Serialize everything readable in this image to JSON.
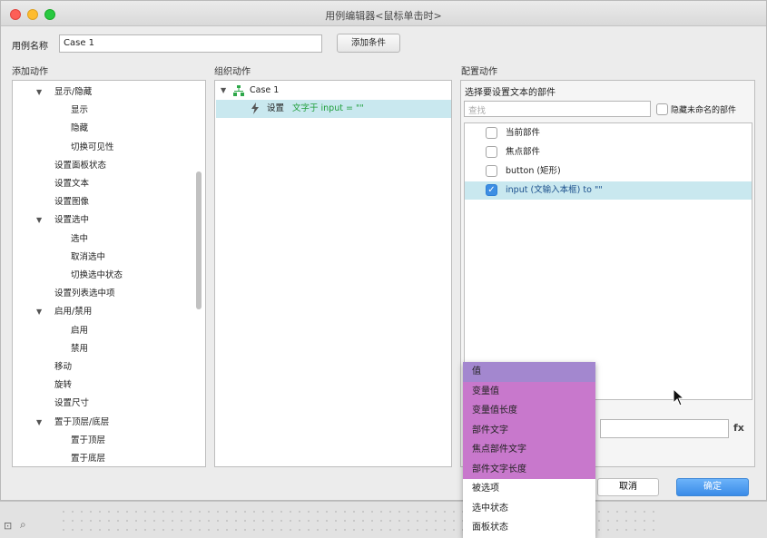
{
  "window": {
    "title": "用例编辑器<鼠标单击时>"
  },
  "case": {
    "label": "用例名称",
    "value": "Case 1",
    "add_condition": "添加条件"
  },
  "sections": {
    "add_action": "添加动作",
    "organize_action": "组织动作",
    "config_action": "配置动作"
  },
  "add_action_tree": [
    {
      "label": "显示/隐藏",
      "level": 1,
      "expanded": true
    },
    {
      "label": "显示",
      "level": 2
    },
    {
      "label": "隐藏",
      "level": 2
    },
    {
      "label": "切换可见性",
      "level": 2
    },
    {
      "label": "设置面板状态",
      "level": 1
    },
    {
      "label": "设置文本",
      "level": 1
    },
    {
      "label": "设置图像",
      "level": 1
    },
    {
      "label": "设置选中",
      "level": 1,
      "expanded": true
    },
    {
      "label": "选中",
      "level": 2
    },
    {
      "label": "取消选中",
      "level": 2
    },
    {
      "label": "切换选中状态",
      "level": 2
    },
    {
      "label": "设置列表选中项",
      "level": 1
    },
    {
      "label": "启用/禁用",
      "level": 1,
      "expanded": true
    },
    {
      "label": "启用",
      "level": 2
    },
    {
      "label": "禁用",
      "level": 2
    },
    {
      "label": "移动",
      "level": 1
    },
    {
      "label": "旋转",
      "level": 1
    },
    {
      "label": "设置尺寸",
      "level": 1
    },
    {
      "label": "置于顶层/底层",
      "level": 1,
      "expanded": true
    },
    {
      "label": "置于顶层",
      "level": 2
    },
    {
      "label": "置于底层",
      "level": 2
    }
  ],
  "organize_tree": {
    "case_name": "Case 1",
    "action_prefix": "设置",
    "action_detail": "文字于 input = \"\""
  },
  "config": {
    "choose_widget_label": "选择要设置文本的部件",
    "search_placeholder": "查找",
    "hide_unnamed_label": "隐藏未命名的部件",
    "widgets": [
      {
        "label": "当前部件",
        "checked": false
      },
      {
        "label": "焦点部件",
        "checked": false
      },
      {
        "label": "button (矩形)",
        "checked": false
      },
      {
        "label": "input (文输入本框) to \"\"",
        "checked": true
      }
    ],
    "fx_label": "fx"
  },
  "dropdown": {
    "items": [
      {
        "label": "值",
        "style": "highlight"
      },
      {
        "label": "变量值",
        "style": "purple"
      },
      {
        "label": "变量值长度",
        "style": "purple"
      },
      {
        "label": "部件文字",
        "style": "purple"
      },
      {
        "label": "焦点部件文字",
        "style": "purple"
      },
      {
        "label": "部件文字长度",
        "style": "purple"
      },
      {
        "label": "被选项",
        "style": "plain"
      },
      {
        "label": "选中状态",
        "style": "plain"
      },
      {
        "label": "面板状态",
        "style": "plain"
      }
    ]
  },
  "buttons": {
    "cancel": "取消",
    "ok": "确定"
  },
  "colors": {
    "selection": "#c9e8ef",
    "ok_blue": "#3a8be8",
    "dropdown_purple": "#c878cc",
    "dropdown_highlight": "#a387cf",
    "action_green": "#1f9e3a"
  }
}
